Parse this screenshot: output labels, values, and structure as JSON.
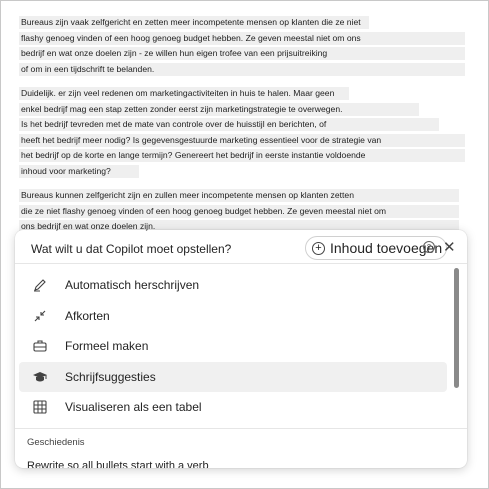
{
  "document": {
    "paragraphs": [
      {
        "lines": [
          "Bureaus zijn vaak zelfgericht en zetten meer incompetente mensen op klanten die ze niet",
          "flashy genoeg vinden of een hoog genoeg budget hebben. Ze geven meestal niet om ons",
          "bedrijf en wat onze doelen zijn - ze willen hun eigen trofee van een prijsuitreiking",
          "of om in een tijdschrift te belanden."
        ]
      },
      {
        "lines": [
          "Duidelijk. er zijn veel redenen om marketingactiviteiten in huis te halen. Maar geen",
          "enkel bedrijf mag een stap zetten zonder eerst zijn marketingstrategie te overwegen.",
          "Is het bedrijf tevreden met de mate van controle over de huisstijl en berichten, of",
          "heeft het bedrijf meer nodig? Is gegevensgestuurde marketing essentieel voor de strategie van",
          "het bedrijf op de korte en lange termijn? Genereert het bedrijf in eerste instantie voldoende",
          "inhoud voor marketing?"
        ]
      },
      {
        "lines": [
          "Bureaus kunnen zelfgericht zijn en zullen meer incompetente mensen op klanten zetten",
          "die ze niet flashy genoeg vinden of een hoog genoeg budget hebben. Ze geven meestal niet om",
          "ons bedrijf en wat onze doelen zijn."
        ]
      }
    ]
  },
  "copilot": {
    "prompt": "Wat wilt u dat Copilot moet opstellen?",
    "add_content_label": "Inhoud toevoegen",
    "menu": [
      {
        "label": "Automatisch herschrijven",
        "icon": "rewrite-pen-icon"
      },
      {
        "label": "Afkorten",
        "icon": "shrink-arrows-icon"
      },
      {
        "label": "Formeel maken",
        "icon": "briefcase-icon"
      },
      {
        "label": "Schrijfsuggesties",
        "icon": "graduation-cap-icon"
      },
      {
        "label": "Visualiseren als een tabel",
        "icon": "table-icon"
      }
    ],
    "history_label": "Geschiedenis",
    "history_items": [
      "Rewrite so all bullets start with a verb"
    ]
  }
}
